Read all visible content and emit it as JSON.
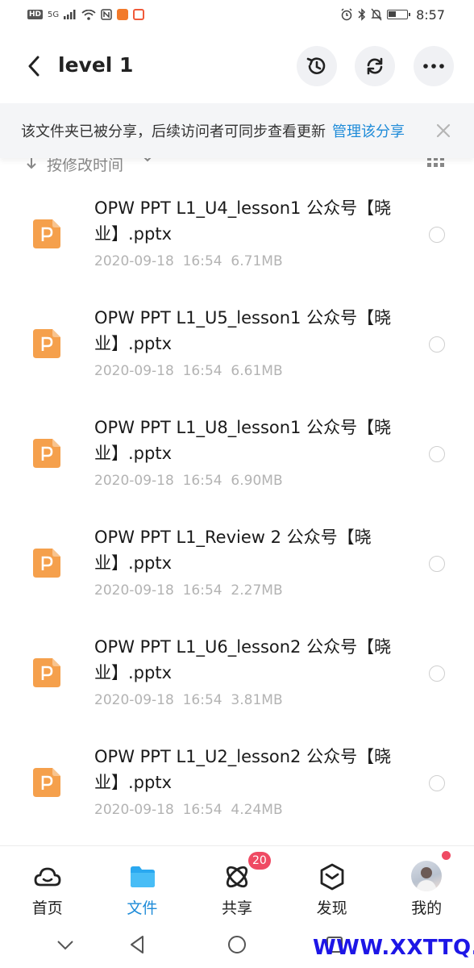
{
  "status_bar": {
    "left_badges": [
      "HD",
      "5G"
    ],
    "time": "8:57",
    "icons": [
      "signal-icon",
      "wifi-icon",
      "nfc-icon",
      "app-notification-icon",
      "alarm-icon",
      "bluetooth-icon",
      "mute-icon",
      "battery-icon"
    ]
  },
  "header": {
    "title": "level 1",
    "actions": [
      "history-icon",
      "sync-icon",
      "more-icon"
    ]
  },
  "share_banner": {
    "text": "该文件夹已被分享，后续访问者可同步查看更新",
    "link": "管理该分享"
  },
  "sort": {
    "label": "按修改时间"
  },
  "files": [
    {
      "name": "OPW PPT L1_U4_lesson1 公众号【晓业】.pptx",
      "date": "2020-09-18",
      "time": "16:54",
      "size": "6.71MB"
    },
    {
      "name": "OPW PPT L1_U5_lesson1 公众号【晓业】.pptx",
      "date": "2020-09-18",
      "time": "16:54",
      "size": "6.61MB"
    },
    {
      "name": "OPW PPT L1_U8_lesson1 公众号【晓业】.pptx",
      "date": "2020-09-18",
      "time": "16:54",
      "size": "6.90MB"
    },
    {
      "name": "OPW PPT L1_Review 2 公众号【晓业】.pptx",
      "date": "2020-09-18",
      "time": "16:54",
      "size": "2.27MB"
    },
    {
      "name": "OPW PPT L1_U6_lesson2 公众号【晓业】.pptx",
      "date": "2020-09-18",
      "time": "16:54",
      "size": "3.81MB"
    },
    {
      "name": "OPW PPT L1_U2_lesson2 公众号【晓业】.pptx",
      "date": "2020-09-18",
      "time": "16:54",
      "size": "4.24MB"
    }
  ],
  "bottom_nav": {
    "items": [
      {
        "label": "首页",
        "icon": "home-cloud-icon",
        "active": false
      },
      {
        "label": "文件",
        "icon": "folder-icon",
        "active": true
      },
      {
        "label": "共享",
        "icon": "share-atom-icon",
        "active": false
      },
      {
        "label": "发现",
        "icon": "discover-cube-icon",
        "active": false
      },
      {
        "label": "我的",
        "icon": "avatar",
        "active": false
      }
    ],
    "share_badge": "20"
  },
  "watermark": "WWW.XXTTQ.COM",
  "colors": {
    "accent": "#1e8bd8",
    "pptx_icon": "#f5a04c",
    "badge": "#ef4a63",
    "watermark": "#1d16e6"
  }
}
